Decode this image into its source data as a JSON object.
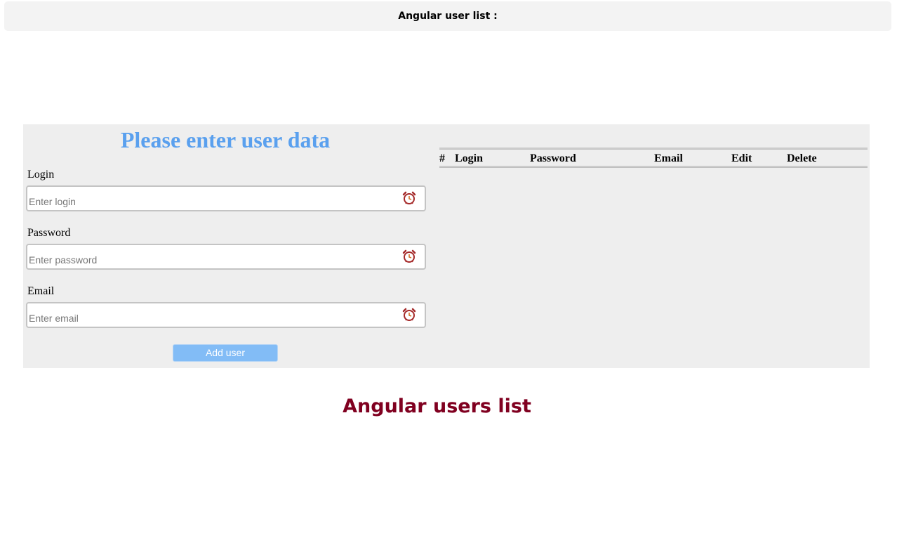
{
  "header": {
    "title": "Angular user list :"
  },
  "form": {
    "title": "Please enter user data",
    "fields": [
      {
        "label": "Login",
        "placeholder": "Enter login",
        "value": "",
        "icon": "alarm-clock-icon"
      },
      {
        "label": "Password",
        "placeholder": "Enter password",
        "value": "",
        "icon": "alarm-clock-icon"
      },
      {
        "label": "Email",
        "placeholder": "Enter email",
        "value": "",
        "icon": "alarm-clock-icon"
      }
    ],
    "submit_label": "Add user"
  },
  "table": {
    "columns": [
      "#",
      "Login",
      "Password",
      "Email",
      "Edit",
      "Delete"
    ],
    "rows": []
  },
  "footer": {
    "title": "Angular users list"
  },
  "colors": {
    "form_title": "#5aa0ee",
    "button": "#82bcf6",
    "footer_title": "#800020",
    "panel": "#eeeeee"
  }
}
